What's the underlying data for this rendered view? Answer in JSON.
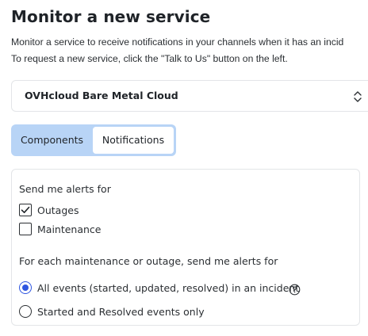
{
  "page": {
    "title": "Monitor a new service",
    "description_line1": "Monitor a service to receive notifications in your channels when it has an incid",
    "description_line2": "To request a new service, click the \"Talk to Us\" button on the left."
  },
  "service_select": {
    "value": "OVHcloud Bare Metal Cloud",
    "icon": "chevron-up-down-icon"
  },
  "tabs": [
    {
      "label": "Components",
      "active": true
    },
    {
      "label": "Notifications",
      "active": false
    }
  ],
  "alerts": {
    "section_label": "Send me alerts for",
    "options": [
      {
        "label": "Outages",
        "checked": true
      },
      {
        "label": "Maintenance",
        "checked": false
      }
    ],
    "events_label": "For each maintenance or outage, send me alerts for",
    "event_options": [
      {
        "label": "All events (started, updated, resolved) in an incident",
        "selected": true
      },
      {
        "label": "Started and Resolved events only",
        "selected": false
      }
    ],
    "help_icon": "question-circle-icon"
  },
  "colors": {
    "tab_bar": "#b8d4f6",
    "accent": "#2e55e0",
    "border": "#e3e5e8"
  }
}
